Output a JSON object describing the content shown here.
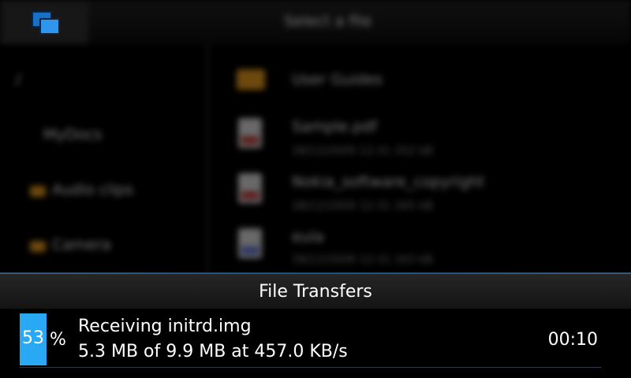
{
  "background_app": {
    "title": "Select a file",
    "sidebar": {
      "path": "/",
      "items": [
        "MyDocs",
        "Audio clips",
        "Camera"
      ]
    },
    "files": [
      {
        "name": "User Guides",
        "details": ""
      },
      {
        "name": "Sample.pdf",
        "details": "28/12/2009 12:31 252 kB"
      },
      {
        "name": "Nokia_software_copyright",
        "details": "28/12/2009 12:31 265 kB"
      },
      {
        "name": "eula",
        "details": "28/12/2009 12:31 163 kB"
      }
    ]
  },
  "panel": {
    "title": "File Transfers",
    "transfer": {
      "progress_percent": 53,
      "progress_label": "53",
      "unit": "%",
      "title": "Receiving initrd.img",
      "detail": "5.3 MB of 9.9 MB at 457.0 KB/s",
      "elapsed": "00:10"
    }
  },
  "colors": {
    "accent": "#29a8f3",
    "panel_background": "#000000",
    "header_background": "#1e1e1e"
  },
  "icons": {
    "switcher": "task-switcher-icon",
    "folder": "folder-icon",
    "file": "file-icon"
  }
}
